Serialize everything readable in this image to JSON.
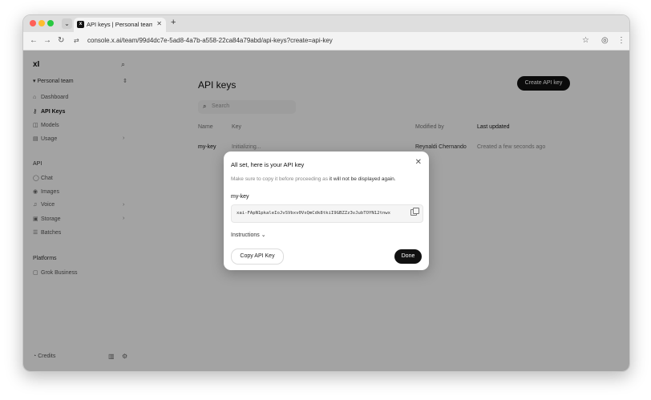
{
  "browser": {
    "tab_title": "API keys | Personal team | xAI",
    "url": "console.x.ai/team/99d4dc7e-5ad8-4a7b-a558-22ca84a79abd/api-keys?create=api-key"
  },
  "sidebar": {
    "logo": "xI",
    "team": "Personal team",
    "items": [
      {
        "label": "Dashboard",
        "icon": "home-icon"
      },
      {
        "label": "API Keys",
        "icon": "key-icon"
      },
      {
        "label": "Models",
        "icon": "cube-icon"
      },
      {
        "label": "Usage",
        "icon": "chart-icon"
      }
    ],
    "api_section": "API",
    "api_items": [
      {
        "label": "Chat"
      },
      {
        "label": "Images"
      },
      {
        "label": "Voice"
      },
      {
        "label": "Storage"
      },
      {
        "label": "Batches"
      }
    ],
    "platforms_section": "Platforms",
    "platform_items": [
      {
        "label": "Grok Business"
      }
    ],
    "credits": "Credits"
  },
  "main": {
    "title": "API keys",
    "create_button": "Create API key",
    "search_placeholder": "Search",
    "columns": [
      "Name",
      "Key",
      "Modified by",
      "Last updated"
    ],
    "rows": [
      {
        "name": "my-key",
        "key": "Initializing...",
        "modified_by": "Reynaldi Chernando",
        "last_updated": "Created a few seconds ago"
      }
    ]
  },
  "modal": {
    "title": "All set, here is your API key",
    "desc_prefix": "Make sure to copy it before proceeding as ",
    "desc_bold": "it will not be displayed again.",
    "key_name": "my-key",
    "key_value": "xai-FApN1pkaleIoJvSVbxv0VsQmCdk8tkiI9GBZZz3vJubTOYN12tnwx",
    "instructions": "Instructions",
    "copy_button": "Copy API Key",
    "done_button": "Done"
  }
}
